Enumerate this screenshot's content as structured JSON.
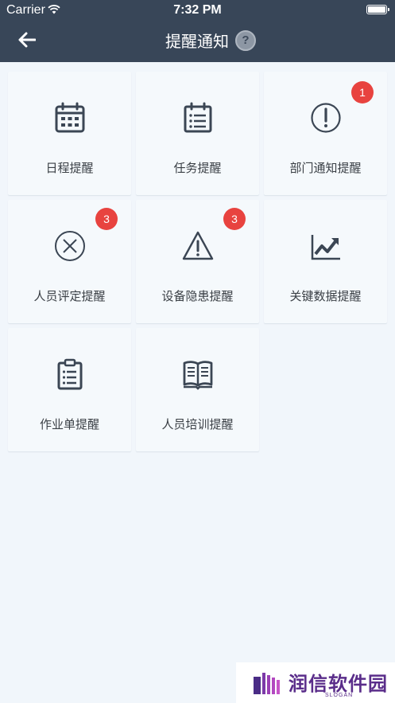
{
  "status_bar": {
    "carrier": "Carrier",
    "time": "7:32 PM",
    "battery_level": 1.0
  },
  "nav": {
    "title": "提醒通知",
    "help_label": "?",
    "back_icon": "arrow-left-icon",
    "help_icon": "question-circle-icon"
  },
  "colors": {
    "header_bg": "#384658",
    "page_bg": "#f1f6fb",
    "icon_color": "#3b4654",
    "badge_bg": "#e8433f"
  },
  "tiles": [
    {
      "label": "日程提醒",
      "icon": "calendar-icon",
      "badge": ""
    },
    {
      "label": "任务提醒",
      "icon": "task-list-icon",
      "badge": ""
    },
    {
      "label": "部门通知提醒",
      "icon": "exclamation-circle-icon",
      "badge": "1"
    },
    {
      "label": "人员评定提醒",
      "icon": "x-circle-icon",
      "badge": "3"
    },
    {
      "label": "设备隐患提醒",
      "icon": "warning-triangle-icon",
      "badge": "3"
    },
    {
      "label": "关键数据提醒",
      "icon": "trend-chart-icon",
      "badge": ""
    },
    {
      "label": "作业单提醒",
      "icon": "clipboard-icon",
      "badge": ""
    },
    {
      "label": "人员培训提醒",
      "icon": "open-book-icon",
      "badge": ""
    }
  ],
  "watermark": {
    "name": "润信软件园",
    "slogan": "SLOGAN"
  }
}
